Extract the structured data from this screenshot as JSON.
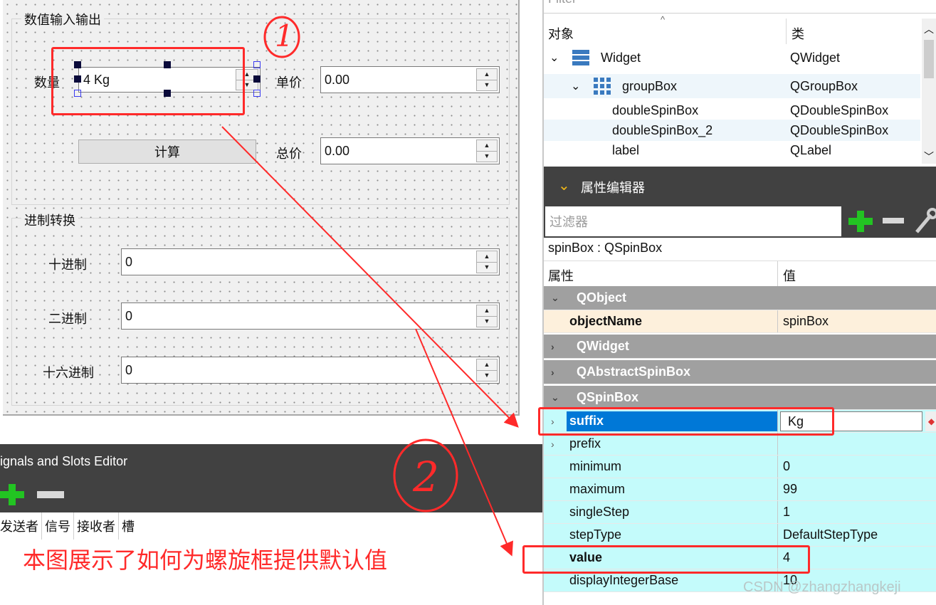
{
  "form": {
    "group1_title": "数值输入输出",
    "quantity_label": "数量",
    "quantity_value": "4 Kg",
    "unit_price_label": "单价",
    "unit_price_value": "0.00",
    "calc_button": "计算",
    "total_label": "总价",
    "total_value": "0.00",
    "group2_title": "进制转换",
    "decimal_label": "十进制",
    "decimal_value": "0",
    "binary_label": "二进制",
    "binary_value": "0",
    "hex_label": "十六进制",
    "hex_value": "0"
  },
  "signals": {
    "title": "ignals and Slots Editor",
    "columns": [
      "发送者",
      "信号",
      "接收者",
      "槽"
    ]
  },
  "caption": "本图展示了如何为螺旋框提供默认值",
  "annotations": {
    "one": "1",
    "two": "2"
  },
  "object_inspector": {
    "filter_placeholder": "Filter",
    "col_object": "对象",
    "col_class": "类",
    "rows": [
      {
        "name": "Widget",
        "cls": "QWidget"
      },
      {
        "name": "groupBox",
        "cls": "QGroupBox"
      },
      {
        "name": "doubleSpinBox",
        "cls": "QDoubleSpinBox"
      },
      {
        "name": "doubleSpinBox_2",
        "cls": "QDoubleSpinBox"
      },
      {
        "name": "label",
        "cls": "QLabel"
      }
    ]
  },
  "property_editor": {
    "title": "属性编辑器",
    "filter_placeholder": "过滤器",
    "object_line": "spinBox : QSpinBox",
    "col_property": "属性",
    "col_value": "值",
    "cat_qobject": "QObject",
    "object_name_key": "objectName",
    "object_name_val": "spinBox",
    "cat_qwidget": "QWidget",
    "cat_qabstractspinbox": "QAbstractSpinBox",
    "cat_qspinbox": "QSpinBox",
    "props": [
      {
        "name": "suffix",
        "value": "Kg"
      },
      {
        "name": "prefix",
        "value": ""
      },
      {
        "name": "minimum",
        "value": "0"
      },
      {
        "name": "maximum",
        "value": "99"
      },
      {
        "name": "singleStep",
        "value": "1"
      },
      {
        "name": "stepType",
        "value": "DefaultStepType"
      },
      {
        "name": "value",
        "value": "4"
      },
      {
        "name": "displayIntegerBase",
        "value": "10"
      }
    ]
  },
  "watermark": "CSDN @zhangzhangkeji",
  "colors": {
    "annotation_red": "#ff2a2a",
    "selection_blue": "#0078d7",
    "cyan_row": "#c4fbfb",
    "dark_header": "#414141"
  }
}
